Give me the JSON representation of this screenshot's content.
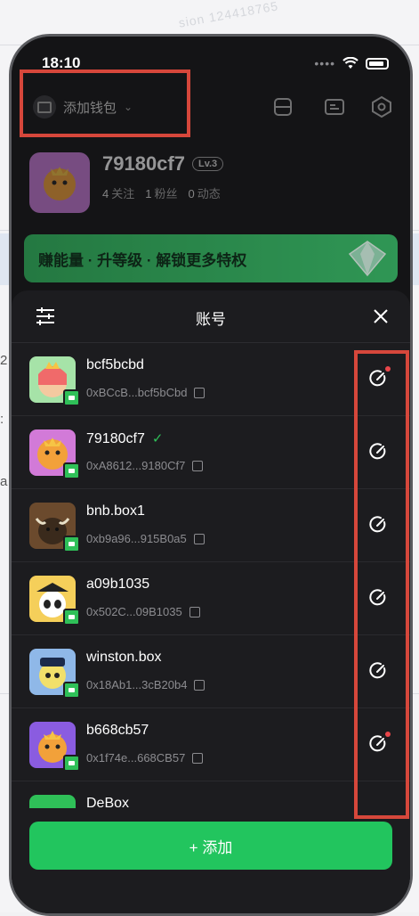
{
  "status_bar": {
    "time": "18:10"
  },
  "header": {
    "wallet_label": "添加钱包",
    "icons": [
      "scan-icon",
      "card-icon",
      "settings-icon"
    ]
  },
  "profile": {
    "name": "79180cf7",
    "level": "Lv.3",
    "stats": [
      {
        "count": "4",
        "label": "关注"
      },
      {
        "count": "1",
        "label": "粉丝"
      },
      {
        "count": "0",
        "label": "动态"
      }
    ]
  },
  "banner": {
    "text": "赚能量 · 升等级 · 解锁更多特权"
  },
  "sheet": {
    "title": "账号",
    "accounts": [
      {
        "name": "bcf5bcbd",
        "address": "0xBCcB...bcf5bCbd",
        "avatar_color": "#a6e3a8",
        "checked": false,
        "red_dot": true
      },
      {
        "name": "79180cf7",
        "address": "0xA8612...9180Cf7",
        "avatar_color": "#d27ad8",
        "checked": true,
        "red_dot": false
      },
      {
        "name": "bnb.box1",
        "address": "0xb9a96...915B0a5",
        "avatar_color": "#6b4a2d",
        "checked": false,
        "red_dot": false
      },
      {
        "name": "a09b1035",
        "address": "0x502C...09B1035",
        "avatar_color": "#f5cf5a",
        "checked": false,
        "red_dot": false
      },
      {
        "name": "winston.box",
        "address": "0x18Ab1...3cB20b4",
        "avatar_color": "#8fb8e8",
        "checked": false,
        "red_dot": false
      },
      {
        "name": "b668cb57",
        "address": "0x1f74e...668CB57",
        "avatar_color": "#8a5ce0",
        "checked": false,
        "red_dot": true
      },
      {
        "name": "DeBox",
        "address": "",
        "avatar_color": "#2fc058",
        "checked": false,
        "red_dot": true
      }
    ],
    "check_mark": "✓",
    "add_label": "+ 添加"
  },
  "background": {
    "watermark": "sion 124418765",
    "edge_text": [
      "2",
      ":",
      "a"
    ]
  },
  "colors": {
    "accent_green": "#22c55e",
    "annotation_red": "#d6473b",
    "sheet_bg": "#1c1c1f"
  }
}
